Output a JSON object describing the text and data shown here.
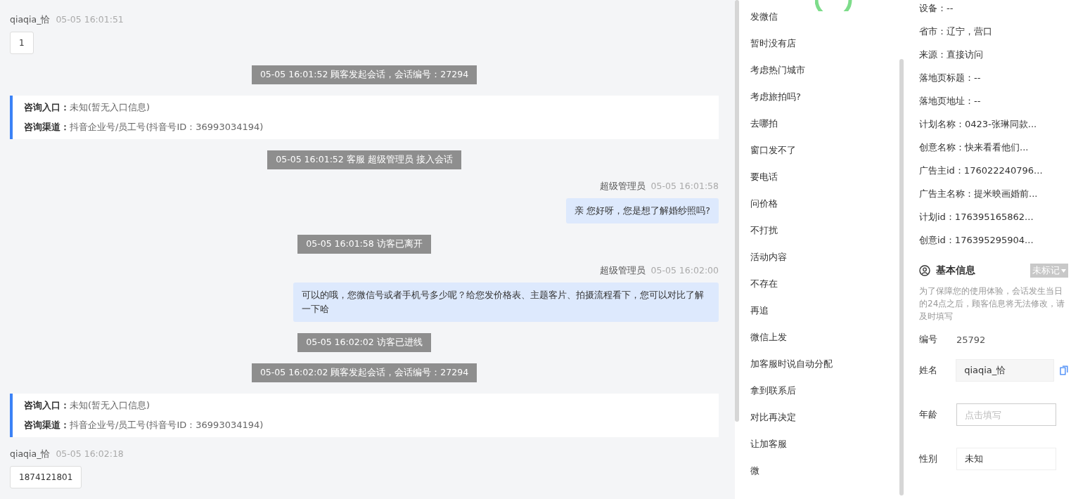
{
  "chat": {
    "messages": [
      {
        "kind": "customer",
        "sender": "qiaqia_恰",
        "time": "05-05 16:01:51",
        "text": "1"
      },
      {
        "kind": "notice",
        "text": "05-05 16:01:52 顾客发起会话，会话编号：27294"
      },
      {
        "kind": "entry",
        "rows": [
          {
            "label": "咨询入口：",
            "value": "未知(暂无入口信息)"
          },
          {
            "label": "咨询渠道：",
            "value": "抖音企业号/员工号(抖音号ID：36993034194)"
          }
        ]
      },
      {
        "kind": "notice",
        "text": "05-05 16:01:52 客服 超级管理员 接入会话"
      },
      {
        "kind": "agent",
        "sender": "超级管理员",
        "time": "05-05 16:01:58",
        "text": "亲 您好呀，您是想了解婚纱照吗?"
      },
      {
        "kind": "notice",
        "text": "05-05 16:01:58 访客已离开"
      },
      {
        "kind": "agent",
        "sender": "超级管理员",
        "time": "05-05 16:02:00",
        "text": "可以的哦，您微信号或者手机号多少呢？给您发价格表、主题客片、拍摄流程看下，您可以对比了解一下哈"
      },
      {
        "kind": "notice",
        "text": "05-05 16:02:02 访客已进线"
      },
      {
        "kind": "notice",
        "text": "05-05 16:02:02 顾客发起会话，会话编号：27294"
      },
      {
        "kind": "entry",
        "rows": [
          {
            "label": "咨询入口：",
            "value": "未知(暂无入口信息)"
          },
          {
            "label": "咨询渠道：",
            "value": "抖音企业号/员工号(抖音号ID：36993034194)"
          }
        ]
      },
      {
        "kind": "customer",
        "sender": "qiaqia_恰",
        "time": "05-05 16:02:18",
        "text": "1874121801"
      }
    ]
  },
  "quick_replies": [
    "发微信",
    "暂时没有店",
    "考虑热门城市",
    "考虑旅拍吗?",
    "去哪拍",
    "窗口发不了",
    "要电话",
    "问价格",
    "不打扰",
    "活动内容",
    "不存在",
    "再追",
    "微信上发",
    "加客服时说自动分配",
    "拿到联系后",
    "对比再决定",
    "让加客服",
    "微"
  ],
  "visitor_details": [
    "设备：--",
    "省市：辽宁，营口",
    "来源：直接访问",
    "落地页标题：--",
    "落地页地址：--",
    "计划名称：0423-张琳同款...",
    "创意名称：快来看看他们...",
    "广告主id：176022240796...",
    "广告主名称：提米映画婚前...",
    "计划id：176395165862...",
    "创意id：176395295904..."
  ],
  "basic_info": {
    "title": "基本信息",
    "tag": "未标记",
    "note": "为了保障您的使用体验，会话发生当日的24点之后，顾客信息将无法修改，请及时填写",
    "fields": [
      {
        "kind": "text",
        "label": "编号",
        "value": "25792"
      },
      {
        "kind": "readonly",
        "label": "姓名",
        "value": "qiaqia_恰"
      },
      {
        "kind": "input",
        "label": "年龄",
        "placeholder": "点击填写"
      },
      {
        "kind": "box",
        "label": "性别",
        "value": "未知"
      }
    ]
  }
}
